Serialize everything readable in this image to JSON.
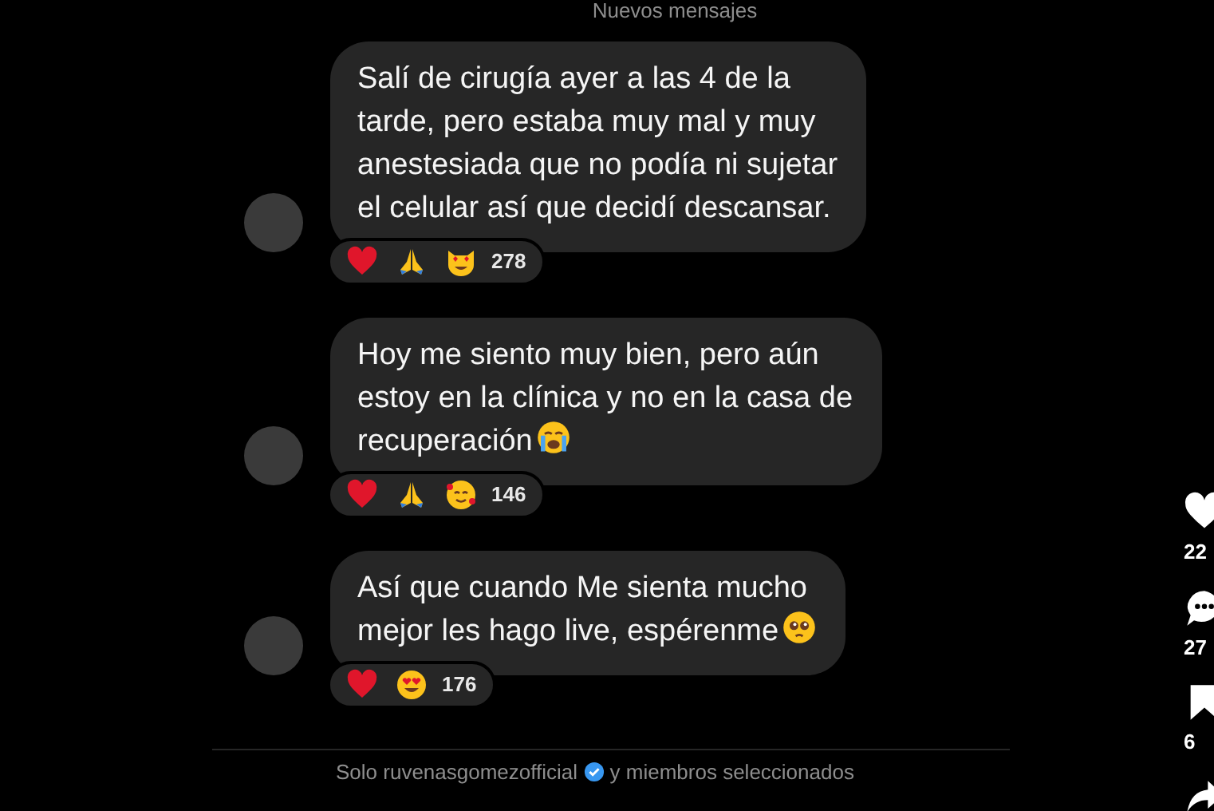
{
  "divider_label": "Nuevos mensajes",
  "messages": [
    {
      "lines": [
        "Salí de cirugía ayer a las 4 de la",
        "tarde, pero estaba muy mal y muy",
        "anestesiada que no podía ni sujetar",
        "el celular así que decidí descansar."
      ],
      "kind": "plain",
      "reactions": [
        {
          "kind": "heart"
        },
        {
          "kind": "pray"
        },
        {
          "kind": "cat"
        }
      ],
      "count": "278"
    },
    {
      "lines": [
        "Hoy me siento muy bien, pero aún",
        "estoy en la clínica y no en la casa de",
        "recuperación"
      ],
      "kind": "crying",
      "reactions": [
        {
          "kind": "heart"
        },
        {
          "kind": "pray"
        },
        {
          "kind": "hearts"
        }
      ],
      "count": "146"
    },
    {
      "lines": [
        "Así que cuando Me sienta mucho",
        "mejor les hago live, espérenme"
      ],
      "kind": "pleading",
      "reactions": [
        {
          "kind": "heart"
        },
        {
          "kind": "hearteyes"
        }
      ],
      "count": "176"
    }
  ],
  "footer": {
    "before": "Solo ruvenasgomezofficial",
    "after": "y miembros seleccionados"
  },
  "side_rail": [
    {
      "kind": "like",
      "count": "22"
    },
    {
      "kind": "comment",
      "count": "27"
    },
    {
      "kind": "save",
      "count": "6"
    },
    {
      "kind": "share"
    }
  ]
}
